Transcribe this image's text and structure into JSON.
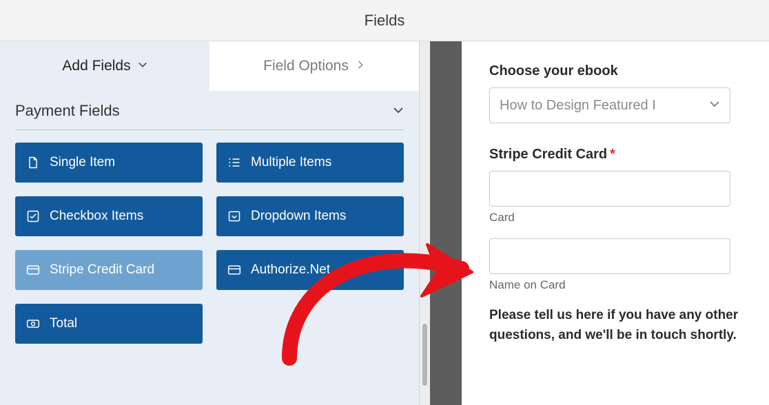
{
  "header": {
    "title": "Fields"
  },
  "tabs": {
    "add": {
      "label": "Add Fields"
    },
    "options": {
      "label": "Field Options"
    }
  },
  "section": {
    "title": "Payment Fields"
  },
  "fields": {
    "single_item": {
      "label": "Single Item"
    },
    "multiple_items": {
      "label": "Multiple Items"
    },
    "checkbox_items": {
      "label": "Checkbox Items"
    },
    "dropdown_items": {
      "label": "Dropdown Items"
    },
    "stripe_card": {
      "label": "Stripe Credit Card"
    },
    "authorize_net": {
      "label": "Authorize.Net"
    },
    "total": {
      "label": "Total"
    }
  },
  "preview": {
    "ebook_label": "Choose your ebook",
    "ebook_value": "How to Design Featured I",
    "stripe_label": "Stripe Credit Card",
    "card_sub": "Card",
    "name_sub": "Name on Card",
    "note": "Please tell us here if you have any other questions, and we'll be in touch shortly."
  },
  "colors": {
    "field_btn": "#125a9c",
    "field_btn_selected": "#6fa3cf",
    "arrow": "#e6141a",
    "panel_bg": "#e7eef5"
  }
}
